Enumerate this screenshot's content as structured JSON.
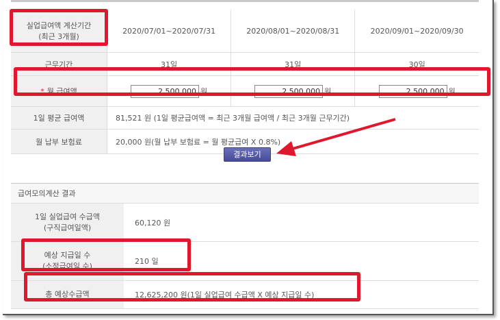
{
  "calc_table": {
    "period_label_line1": "실업급여액 계산기간",
    "period_label_line2": "(최근 3개월)",
    "periods": [
      "2020/07/01~2020/07/31",
      "2020/08/01~2020/08/31",
      "2020/09/01~2020/09/30"
    ],
    "workdays_label": "근무기간",
    "workdays": [
      "31일",
      "31일",
      "30일"
    ],
    "wage_star": "*",
    "wage_label": "월 급여액",
    "wages": [
      "2,500,000",
      "2,500,000",
      "2,500,000"
    ],
    "won_unit": "원",
    "daily_avg_label": "1일 평균 급여액",
    "daily_avg_value": "81,521  원 (1일 평균급여액 = 최근 3개월 급여액 / 최근 3개월 근무기간)",
    "insurance_label": "월 납부 보험료",
    "insurance_value": "20,000  원(월 납부 보험료 = 월 평균급여 X 0.8%)"
  },
  "result_button_label": "결과보기",
  "result_section": {
    "title": "급여모의계산 결과",
    "daily_benefit_label_line1": "1일 실업급여 수급액",
    "daily_benefit_label_line2": "(구직급여일액)",
    "daily_benefit_value": "60,120  원",
    "expected_days_label_line1": "예상 지급일 수",
    "expected_days_label_line2": "(소정급여일 수)",
    "expected_days_value": "210  일",
    "total_label": "총 예상수급액",
    "total_value": "12,625,200  원(1일 실업급여 수급액 X 예상 지급일 수)"
  },
  "colors": {
    "highlight": "#e0182d",
    "button": "#555aa8",
    "label_bg": "#f0f0f0"
  }
}
